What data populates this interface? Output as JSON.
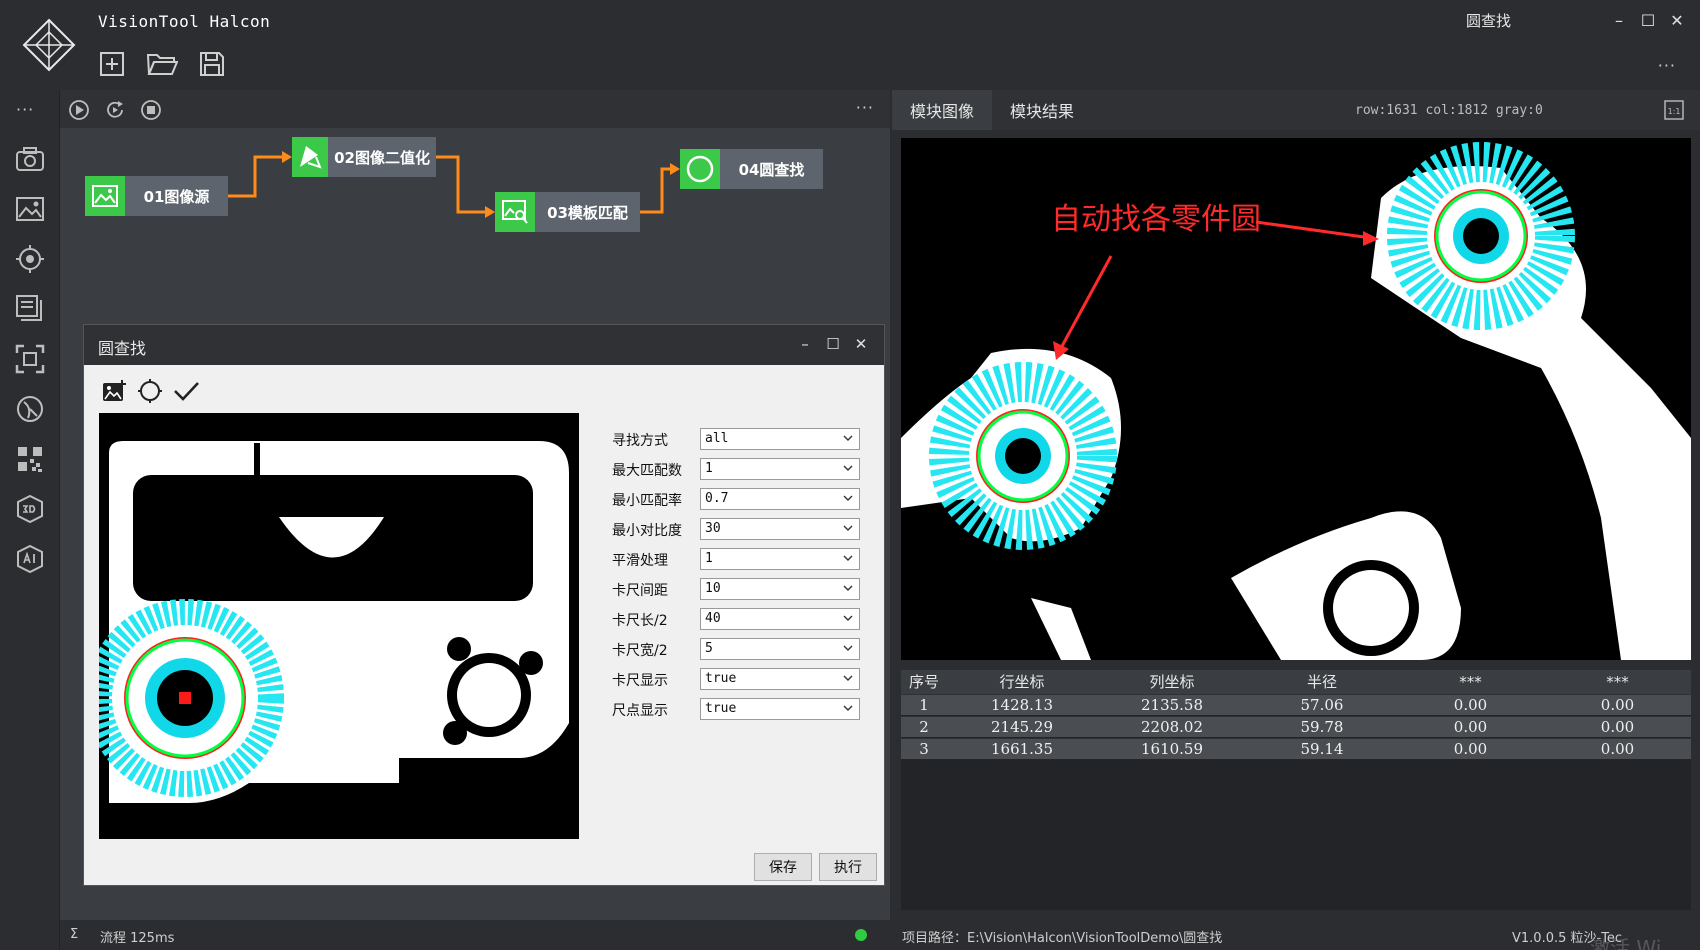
{
  "app": {
    "title": "VisionTool Halcon",
    "window_title": "圆查找",
    "more": "···",
    "minimize": "–",
    "maximize": "☐",
    "close": "✕"
  },
  "flow": {
    "more": "···",
    "nodes": [
      {
        "label": "01图像源"
      },
      {
        "label": "02图像二值化"
      },
      {
        "label": "03模板匹配"
      },
      {
        "label": "04圆查找"
      }
    ],
    "connector_color": "#ff8c1a",
    "node_color": "#3cc94a"
  },
  "dialog": {
    "title": "圆查找",
    "params": [
      {
        "label": "寻找方式",
        "value": "all"
      },
      {
        "label": "最大匹配数",
        "value": "1"
      },
      {
        "label": "最小匹配率",
        "value": "0.7"
      },
      {
        "label": "最小对比度",
        "value": "30"
      },
      {
        "label": "平滑处理",
        "value": "1"
      },
      {
        "label": "卡尺间距",
        "value": "10"
      },
      {
        "label": "卡尺长/2",
        "value": "40"
      },
      {
        "label": "卡尺宽/2",
        "value": "5"
      },
      {
        "label": "卡尺显示",
        "value": "true"
      },
      {
        "label": "尺点显示",
        "value": "true"
      }
    ],
    "save_label": "保存",
    "run_label": "执行"
  },
  "right": {
    "tabs": [
      {
        "label": "模块图像"
      },
      {
        "label": "模块结果"
      }
    ],
    "coord_readout": "row:1631 col:1812 gray:0",
    "annotation": "自动找各零件圆",
    "annotation_color": "#ff2a2a",
    "table": {
      "headers": [
        "序号",
        "行坐标",
        "列坐标",
        "半径",
        "***",
        "***"
      ],
      "rows": [
        [
          "1",
          "1428.13",
          "2135.58",
          "57.06",
          "0.00",
          "0.00"
        ],
        [
          "2",
          "2145.29",
          "2208.02",
          "59.78",
          "0.00",
          "0.00"
        ],
        [
          "3",
          "1661.35",
          "1610.59",
          "59.14",
          "0.00",
          "0.00"
        ]
      ]
    }
  },
  "status": {
    "flow_label": "流程 125ms",
    "sigma": "Σ",
    "project_path": "项目路径：E:\\Vision\\Halcon\\VisionToolDemo\\圆查找",
    "version": "V1.0.0.5 粒沙-Tec",
    "watermark": "激活 Wi"
  }
}
